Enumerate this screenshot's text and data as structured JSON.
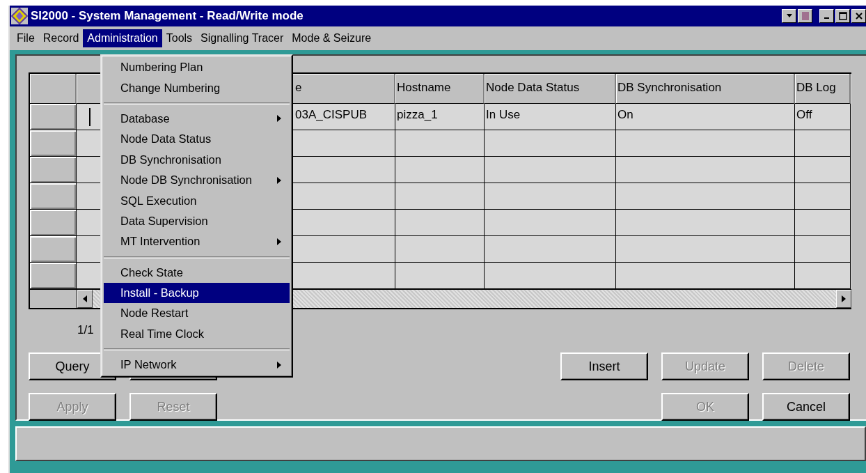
{
  "window": {
    "title": "SI2000 - System Management - Read/Write mode"
  },
  "menu_bar": [
    {
      "label": "File",
      "selected": false
    },
    {
      "label": "Record",
      "selected": false
    },
    {
      "label": "Administration",
      "selected": true
    },
    {
      "label": "Tools",
      "selected": false
    },
    {
      "label": "Signalling Tracer",
      "selected": false
    },
    {
      "label": "Mode & Seizure",
      "selected": false
    }
  ],
  "open_menu": {
    "items": [
      {
        "kind": "item",
        "label": "Numbering Plan",
        "submenu": false,
        "selected": false
      },
      {
        "kind": "item",
        "label": "Change Numbering",
        "submenu": false,
        "selected": false
      },
      {
        "kind": "separator"
      },
      {
        "kind": "item",
        "label": "Database",
        "submenu": true,
        "selected": false
      },
      {
        "kind": "item",
        "label": "Node Data Status",
        "submenu": false,
        "selected": false
      },
      {
        "kind": "item",
        "label": "DB Synchronisation",
        "submenu": false,
        "selected": false
      },
      {
        "kind": "item",
        "label": "Node DB Synchronisation",
        "submenu": true,
        "selected": false
      },
      {
        "kind": "item",
        "label": "SQL Execution",
        "submenu": false,
        "selected": false
      },
      {
        "kind": "item",
        "label": "Data Supervision",
        "submenu": false,
        "selected": false
      },
      {
        "kind": "item",
        "label": "MT Intervention",
        "submenu": true,
        "selected": false
      },
      {
        "kind": "separator"
      },
      {
        "kind": "item",
        "label": "Check State",
        "submenu": false,
        "selected": false
      },
      {
        "kind": "item",
        "label": "Install - Backup",
        "submenu": false,
        "selected": true
      },
      {
        "kind": "item",
        "label": "Node Restart",
        "submenu": false,
        "selected": false
      },
      {
        "kind": "item",
        "label": "Real Time Clock",
        "submenu": false,
        "selected": false
      },
      {
        "kind": "separator"
      },
      {
        "kind": "item",
        "label": "IP Network",
        "submenu": true,
        "selected": false
      }
    ]
  },
  "table": {
    "columns": [
      "e",
      "Hostname",
      "Node Data Status",
      "DB Synchronisation",
      "DB Log"
    ],
    "rows": [
      {
        "cursor": true,
        "cells": [
          "03A_CISPUB",
          "pizza_1",
          "In Use",
          "On",
          "Off"
        ]
      }
    ]
  },
  "pager": "1/1",
  "left_buttons": [
    [
      {
        "label": "Query",
        "disabled": false
      }
    ],
    [
      {
        "label": "Apply",
        "disabled": true
      },
      {
        "label": "Reset",
        "disabled": true
      }
    ]
  ],
  "right_buttons": [
    [
      {
        "label": "Insert",
        "disabled": false
      },
      {
        "label": "Update",
        "disabled": true
      },
      {
        "label": "Delete",
        "disabled": true
      }
    ],
    [
      {
        "label": "OK",
        "disabled": true
      },
      {
        "label": "Cancel",
        "disabled": false
      }
    ]
  ]
}
